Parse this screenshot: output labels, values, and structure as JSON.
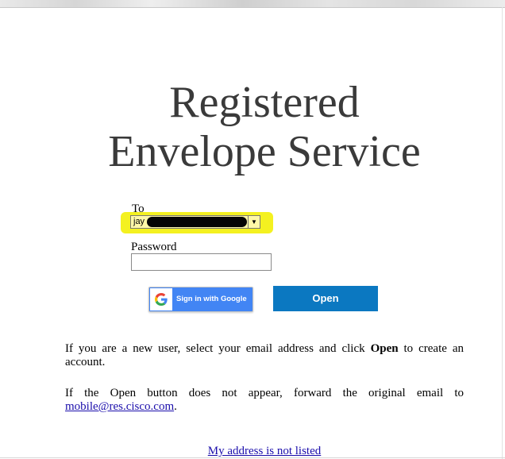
{
  "header": {
    "title_line1": "Registered",
    "title_line2": "Envelope Service"
  },
  "form": {
    "to_label": "To",
    "to_value_visible": "jay",
    "password_label": "Password",
    "password_value": ""
  },
  "buttons": {
    "google_label": "Sign in with Google",
    "open_label": "Open"
  },
  "info": {
    "new_user_before": "If you are a new user, select your email address and click ",
    "new_user_bold": "Open",
    "new_user_after": " to create an account.",
    "forward_text": "If the Open button does not appear, forward the original email to ",
    "forward_email": "mobile@res.cisco.com",
    "forward_end": "."
  },
  "links": {
    "not_listed": "My address is not listed"
  },
  "colors": {
    "highlight": "#f4f120",
    "google_blue": "#4285f4",
    "open_button": "#0b78c1",
    "link": "#1a0dab"
  },
  "icons": {
    "google": "google-g-icon",
    "dropdown": "dropdown-arrow-icon"
  }
}
